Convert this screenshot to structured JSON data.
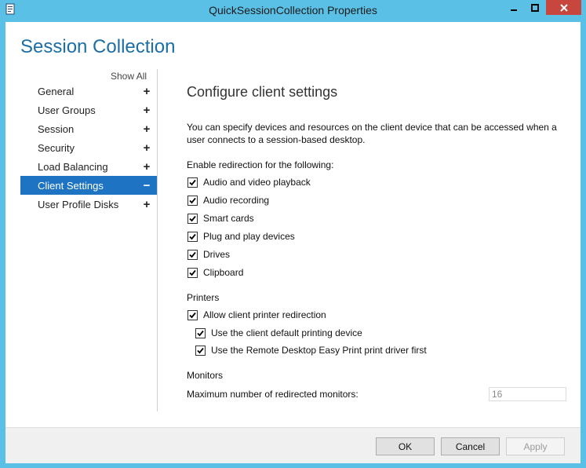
{
  "window": {
    "title": "QuickSessionCollection Properties",
    "icons": {
      "app": "properties-icon",
      "minimize": "minimize-icon",
      "maximize": "maximize-icon",
      "close": "close-icon"
    }
  },
  "header": {
    "title": "Session Collection"
  },
  "sidebar": {
    "show_all": "Show All",
    "items": [
      {
        "label": "General",
        "sign": "+"
      },
      {
        "label": "User Groups",
        "sign": "+"
      },
      {
        "label": "Session",
        "sign": "+"
      },
      {
        "label": "Security",
        "sign": "+"
      },
      {
        "label": "Load Balancing",
        "sign": "+"
      },
      {
        "label": "Client Settings",
        "sign": "−",
        "selected": true
      },
      {
        "label": "User Profile Disks",
        "sign": "+"
      }
    ]
  },
  "main": {
    "title": "Configure client settings",
    "description": "You can specify devices and resources on the client device that can be accessed when a user connects to a session-based desktop.",
    "redirection": {
      "label": "Enable redirection for the following:",
      "items": [
        {
          "label": "Audio and video playback",
          "checked": true
        },
        {
          "label": "Audio recording",
          "checked": true
        },
        {
          "label": "Smart cards",
          "checked": true
        },
        {
          "label": "Plug and play devices",
          "checked": true
        },
        {
          "label": "Drives",
          "checked": true
        },
        {
          "label": "Clipboard",
          "checked": true
        }
      ]
    },
    "printers": {
      "label": "Printers",
      "allow": {
        "label": "Allow client printer redirection",
        "checked": true
      },
      "default_device": {
        "label": "Use the client default printing device",
        "checked": true
      },
      "easy_print": {
        "label": "Use the Remote Desktop Easy Print print driver first",
        "checked": true
      }
    },
    "monitors": {
      "label": "Monitors",
      "max_label": "Maximum number of redirected monitors:",
      "max_value": "16"
    }
  },
  "footer": {
    "ok": "OK",
    "cancel": "Cancel",
    "apply": "Apply"
  }
}
